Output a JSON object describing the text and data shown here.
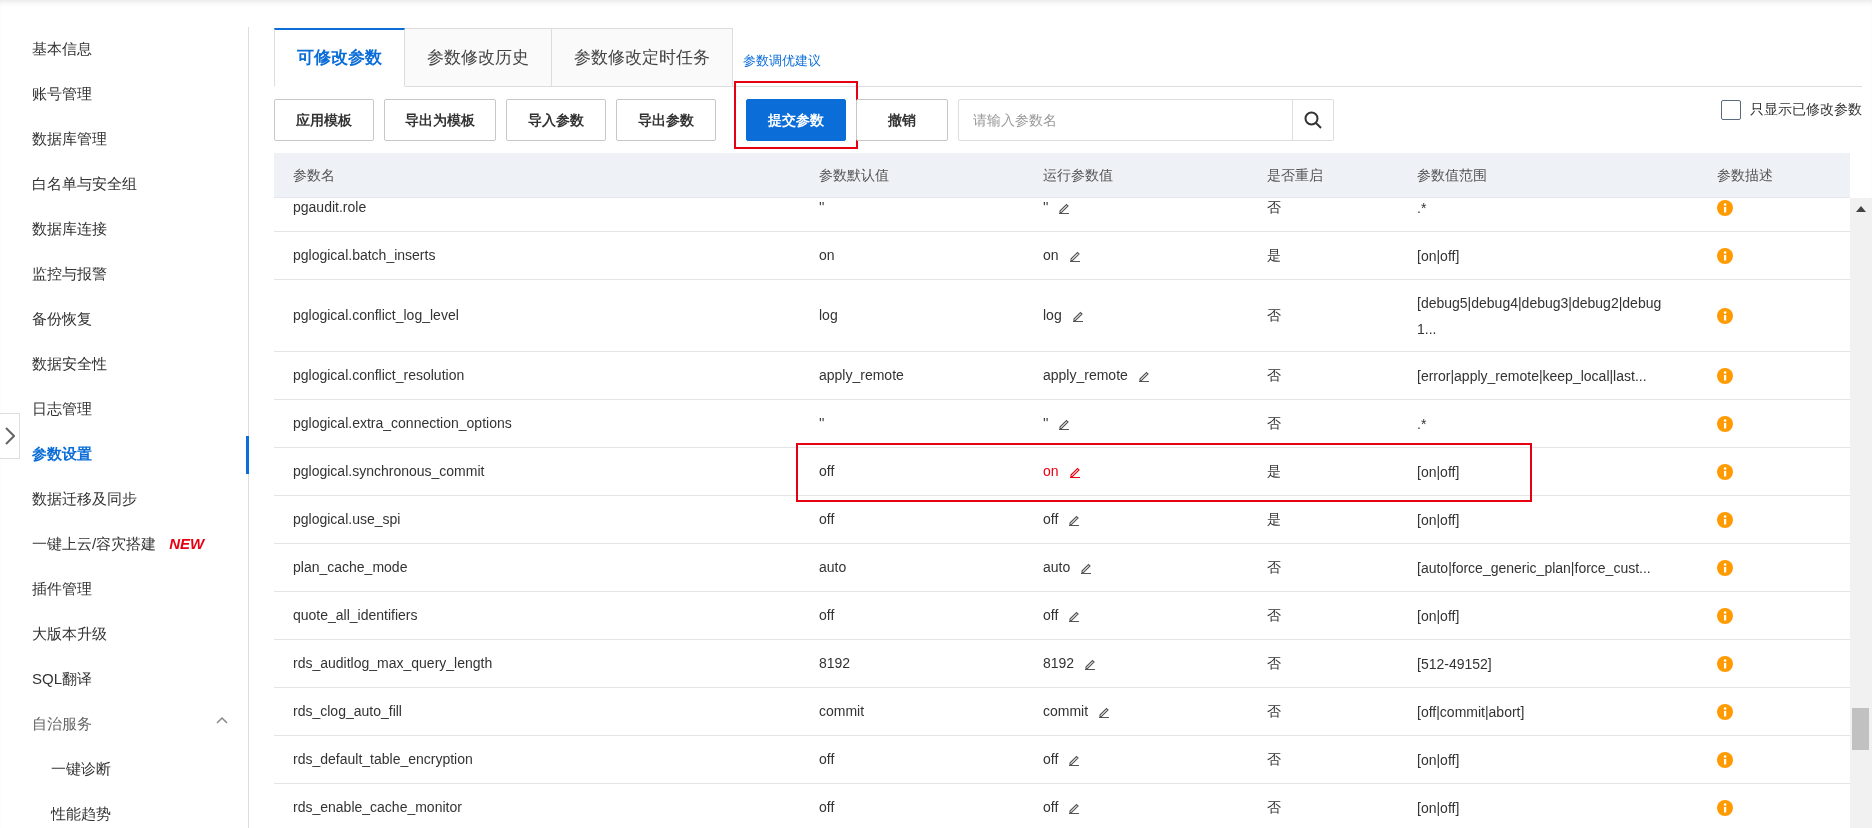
{
  "sidebar": {
    "items": [
      {
        "label": "基本信息",
        "selected": false
      },
      {
        "label": "账号管理",
        "selected": false
      },
      {
        "label": "数据库管理",
        "selected": false
      },
      {
        "label": "白名单与安全组",
        "selected": false
      },
      {
        "label": "数据库连接",
        "selected": false
      },
      {
        "label": "监控与报警",
        "selected": false
      },
      {
        "label": "备份恢复",
        "selected": false
      },
      {
        "label": "数据安全性",
        "selected": false
      },
      {
        "label": "日志管理",
        "selected": false
      },
      {
        "label": "参数设置",
        "selected": true
      },
      {
        "label": "数据迁移及同步",
        "selected": false
      },
      {
        "label": "一键上云/容灾搭建",
        "selected": false,
        "badge": "NEW"
      },
      {
        "label": "插件管理",
        "selected": false
      },
      {
        "label": "大版本升级",
        "selected": false
      },
      {
        "label": "SQL翻译",
        "selected": false
      },
      {
        "label": "自治服务",
        "selected": false,
        "expanded": true,
        "children": [
          {
            "label": "一键诊断",
            "selected": false
          },
          {
            "label": "性能趋势",
            "selected": false
          }
        ]
      }
    ]
  },
  "tabs": [
    {
      "label": "可修改参数",
      "selected": true
    },
    {
      "label": "参数修改历史",
      "selected": false
    },
    {
      "label": "参数修改定时任务",
      "selected": false
    }
  ],
  "tuning_link": "参数调优建议",
  "toolbar": {
    "buttons": [
      {
        "label": "应用模板",
        "primary": false,
        "highlighted": false
      },
      {
        "label": "导出为模板",
        "primary": false,
        "highlighted": false
      },
      {
        "label": "导入参数",
        "primary": false,
        "highlighted": false
      },
      {
        "label": "导出参数",
        "primary": false,
        "highlighted": false
      },
      {
        "label": "提交参数",
        "primary": true,
        "highlighted": true
      },
      {
        "label": "撤销",
        "primary": false,
        "highlighted": false
      }
    ],
    "search": {
      "placeholder": "请输入参数名"
    },
    "only_modified": {
      "label": "只显示已修改参数",
      "checked": false
    }
  },
  "table": {
    "columns": [
      "参数名",
      "参数默认值",
      "运行参数值",
      "是否重启",
      "参数值范围",
      "参数描述"
    ],
    "rows": [
      {
        "name": "pgaudit.role",
        "default": "''",
        "running": "''",
        "restart": "否",
        "range": ".*",
        "modified": false,
        "highlighted": false
      },
      {
        "name": "pglogical.batch_inserts",
        "default": "on",
        "running": "on",
        "restart": "是",
        "range": "[on|off]",
        "modified": false,
        "highlighted": false
      },
      {
        "name": "pglogical.conflict_log_level",
        "default": "log",
        "running": "log",
        "restart": "否",
        "range": "[debug5|debug4|debug3|debug2|debug1...",
        "modified": false,
        "highlighted": false
      },
      {
        "name": "pglogical.conflict_resolution",
        "default": "apply_remote",
        "running": "apply_remote",
        "restart": "否",
        "range": "[error|apply_remote|keep_local|last...",
        "modified": false,
        "highlighted": false
      },
      {
        "name": "pglogical.extra_connection_options",
        "default": "''",
        "running": "''",
        "restart": "否",
        "range": ".*",
        "modified": false,
        "highlighted": false
      },
      {
        "name": "pglogical.synchronous_commit",
        "default": "off",
        "running": "on",
        "restart": "是",
        "range": "[on|off]",
        "modified": true,
        "highlighted": true
      },
      {
        "name": "pglogical.use_spi",
        "default": "off",
        "running": "off",
        "restart": "是",
        "range": "[on|off]",
        "modified": false,
        "highlighted": false
      },
      {
        "name": "plan_cache_mode",
        "default": "auto",
        "running": "auto",
        "restart": "否",
        "range": "[auto|force_generic_plan|force_cust...",
        "modified": false,
        "highlighted": false
      },
      {
        "name": "quote_all_identifiers",
        "default": "off",
        "running": "off",
        "restart": "否",
        "range": "[on|off]",
        "modified": false,
        "highlighted": false
      },
      {
        "name": "rds_auditlog_max_query_length",
        "default": "8192",
        "running": "8192",
        "restart": "否",
        "range": "[512-49152]",
        "modified": false,
        "highlighted": false
      },
      {
        "name": "rds_clog_auto_fill",
        "default": "commit",
        "running": "commit",
        "restart": "否",
        "range": "[off|commit|abort]",
        "modified": false,
        "highlighted": false
      },
      {
        "name": "rds_default_table_encryption",
        "default": "off",
        "running": "off",
        "restart": "否",
        "range": "[on|off]",
        "modified": false,
        "highlighted": false
      },
      {
        "name": "rds_enable_cache_monitor",
        "default": "off",
        "running": "off",
        "restart": "否",
        "range": "[on|off]",
        "modified": false,
        "highlighted": false
      }
    ]
  }
}
